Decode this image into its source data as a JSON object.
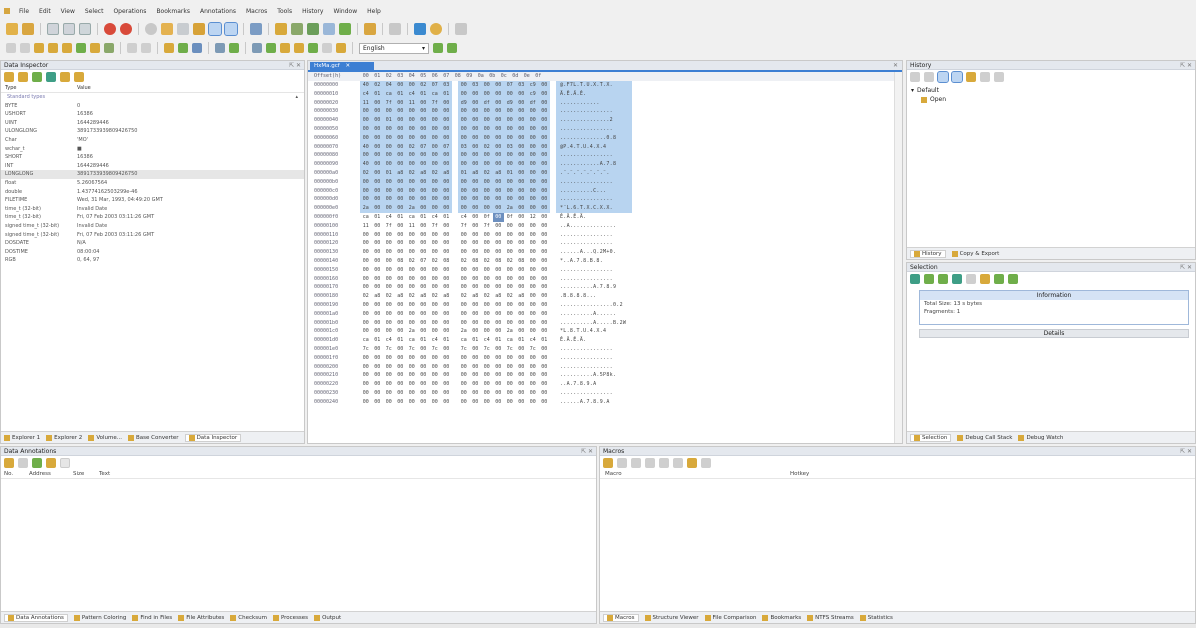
{
  "menu": [
    "File",
    "Edit",
    "View",
    "Select",
    "Operations",
    "Bookmarks",
    "Annotations",
    "Macros",
    "Tools",
    "History",
    "Window",
    "Help"
  ],
  "toolbar2": {
    "language": "English"
  },
  "colors": {
    "selection": "#b8d4f0",
    "tab_active": "#3d7fd3",
    "icon": "#d8a93b"
  },
  "data_inspector": {
    "title": "Data Inspector",
    "columns": [
      "Type",
      "Value"
    ],
    "group_label": "Standard types",
    "rows": [
      {
        "k": "BYTE",
        "v": "0"
      },
      {
        "k": "USHORT",
        "v": "16386"
      },
      {
        "k": "UINT",
        "v": "1644289446"
      },
      {
        "k": "ULONGLONG",
        "v": "3891733939809426750"
      },
      {
        "k": "Char",
        "v": "'MO'"
      },
      {
        "k": "wchar_t",
        "v": "■"
      },
      {
        "k": "SHORT",
        "v": "16386"
      },
      {
        "k": "INT",
        "v": "1644289446"
      },
      {
        "k": "LONGLONG",
        "v": "3891733939809426750"
      },
      {
        "k": "float",
        "v": "5.26067564"
      },
      {
        "k": "double",
        "v": "1.43774162503299e-46"
      },
      {
        "k": "FILETIME",
        "v": "Wed, 31 Mar, 1993, 04:49:20 GMT"
      },
      {
        "k": "time_t (32-bit)",
        "v": "Invalid Date"
      },
      {
        "k": "time_t (32-bit)",
        "v": "Fri, 07 Feb 2003 03:11:26 GMT"
      },
      {
        "k": "signed time_t (32-bit)",
        "v": "Invalid Date"
      },
      {
        "k": "signed time_t (32-bit)",
        "v": "Fri, 07 Feb 2003 03:11:26 GMT"
      },
      {
        "k": "DOSDATE",
        "v": "N/A"
      },
      {
        "k": "DOSTIME",
        "v": "08:00:04"
      },
      {
        "k": "RGB",
        "v": "0, 64, 97"
      }
    ],
    "tabs": [
      "Explorer 1",
      "Explorer 2",
      "Volume...",
      "Base Converter",
      "Data Inspector"
    ]
  },
  "hex_view": {
    "doc_tab": "HxMa.gcf",
    "header": [
      "00",
      "01",
      "02",
      "03",
      "04",
      "05",
      "06",
      "07",
      "08",
      "09",
      "0a",
      "0b",
      "0c",
      "0d",
      "0e",
      "0f"
    ],
    "rows": [
      {
        "off": "00000000",
        "h": [
          "40",
          "02",
          "04",
          "00",
          "00",
          "02",
          "07",
          "03",
          "00",
          "03",
          "00",
          "00",
          "07",
          "03",
          "c9",
          "00"
        ],
        "t": "@.F7L.T.U.X.T.X."
      },
      {
        "off": "00000010",
        "h": [
          "c4",
          "01",
          "ca",
          "01",
          "c4",
          "01",
          "ca",
          "01",
          "00",
          "00",
          "00",
          "00",
          "00",
          "00",
          "c9",
          "00"
        ],
        "t": "Ä.Ê.Ä.Ê."
      },
      {
        "off": "00000020",
        "h": [
          "11",
          "00",
          "7f",
          "00",
          "11",
          "00",
          "7f",
          "00",
          "d9",
          "00",
          "df",
          "00",
          "d9",
          "00",
          "df",
          "00"
        ],
        "t": "............"
      },
      {
        "off": "00000030",
        "h": [
          "00",
          "00",
          "00",
          "00",
          "00",
          "00",
          "00",
          "00",
          "00",
          "00",
          "00",
          "00",
          "00",
          "00",
          "00",
          "00"
        ],
        "t": "................"
      },
      {
        "off": "00000040",
        "h": [
          "00",
          "00",
          "01",
          "00",
          "00",
          "00",
          "00",
          "00",
          "00",
          "00",
          "00",
          "00",
          "00",
          "00",
          "00",
          "00"
        ],
        "t": "...............2"
      },
      {
        "off": "00000050",
        "h": [
          "00",
          "00",
          "00",
          "00",
          "00",
          "00",
          "00",
          "00",
          "00",
          "00",
          "00",
          "00",
          "00",
          "00",
          "00",
          "00"
        ],
        "t": "................"
      },
      {
        "off": "00000060",
        "h": [
          "00",
          "00",
          "00",
          "00",
          "00",
          "00",
          "00",
          "00",
          "00",
          "00",
          "00",
          "00",
          "00",
          "00",
          "00",
          "00"
        ],
        "t": "..............0.8"
      },
      {
        "off": "00000070",
        "h": [
          "40",
          "00",
          "00",
          "00",
          "02",
          "07",
          "00",
          "07",
          "03",
          "00",
          "02",
          "00",
          "03",
          "00",
          "00",
          "00"
        ],
        "t": "@P.4.T.U.4.X.4"
      },
      {
        "off": "00000080",
        "h": [
          "00",
          "00",
          "00",
          "00",
          "00",
          "00",
          "00",
          "00",
          "00",
          "00",
          "00",
          "00",
          "00",
          "00",
          "00",
          "00"
        ],
        "t": "................"
      },
      {
        "off": "00000090",
        "h": [
          "40",
          "00",
          "00",
          "00",
          "00",
          "00",
          "00",
          "00",
          "00",
          "00",
          "00",
          "00",
          "00",
          "00",
          "00",
          "00"
        ],
        "t": "............A.7.8"
      },
      {
        "off": "000000a0",
        "h": [
          "02",
          "00",
          "01",
          "a8",
          "02",
          "a8",
          "02",
          "a8",
          "01",
          "a8",
          "02",
          "a8",
          "01",
          "00",
          "00",
          "00"
        ],
        "t": ".¨.¨.¨.¨.¨.¨.¨."
      },
      {
        "off": "000000b0",
        "h": [
          "00",
          "00",
          "00",
          "00",
          "00",
          "00",
          "00",
          "00",
          "00",
          "00",
          "00",
          "00",
          "00",
          "00",
          "00",
          "00"
        ],
        "t": "................"
      },
      {
        "off": "000000c0",
        "h": [
          "00",
          "00",
          "00",
          "00",
          "00",
          "00",
          "00",
          "00",
          "00",
          "00",
          "00",
          "00",
          "00",
          "00",
          "00",
          "00"
        ],
        "t": "..........C..."
      },
      {
        "off": "000000d0",
        "h": [
          "00",
          "00",
          "00",
          "00",
          "00",
          "00",
          "00",
          "00",
          "00",
          "00",
          "00",
          "00",
          "00",
          "00",
          "00",
          "00"
        ],
        "t": "................"
      },
      {
        "off": "000000e0",
        "h": [
          "2a",
          "00",
          "00",
          "00",
          "2a",
          "00",
          "00",
          "00",
          "00",
          "00",
          "00",
          "00",
          "2a",
          "00",
          "00",
          "00"
        ],
        "t": "*¨L.6.T.X.C.X.X."
      },
      {
        "off": "000000f0",
        "h": [
          "ca",
          "01",
          "c4",
          "01",
          "ca",
          "01",
          "c4",
          "01",
          "c4",
          "00",
          "0f",
          "00",
          "0f",
          "00",
          "12",
          "00"
        ],
        "t": "Ê.Ä.Ê.Ä."
      },
      {
        "off": "00000100",
        "h": [
          "11",
          "00",
          "7f",
          "00",
          "11",
          "00",
          "7f",
          "00",
          "7f",
          "00",
          "7f",
          "00",
          "00",
          "00",
          "00",
          "00"
        ],
        "t": "..A.............."
      },
      {
        "off": "00000110",
        "h": [
          "00",
          "00",
          "00",
          "00",
          "00",
          "00",
          "00",
          "00",
          "00",
          "00",
          "00",
          "00",
          "00",
          "00",
          "00",
          "00"
        ],
        "t": "................"
      },
      {
        "off": "00000120",
        "h": [
          "00",
          "00",
          "00",
          "00",
          "00",
          "00",
          "00",
          "00",
          "00",
          "00",
          "00",
          "00",
          "00",
          "00",
          "00",
          "00"
        ],
        "t": "................"
      },
      {
        "off": "00000130",
        "h": [
          "00",
          "00",
          "00",
          "00",
          "00",
          "00",
          "00",
          "00",
          "00",
          "00",
          "00",
          "00",
          "00",
          "00",
          "00",
          "00"
        ],
        "t": "......A...Q.2M+0."
      },
      {
        "off": "00000140",
        "h": [
          "00",
          "00",
          "00",
          "08",
          "02",
          "07",
          "02",
          "08",
          "02",
          "08",
          "02",
          "08",
          "02",
          "08",
          "00",
          "00"
        ],
        "t": "*..A.7.8.B.8."
      },
      {
        "off": "00000150",
        "h": [
          "00",
          "00",
          "00",
          "00",
          "00",
          "00",
          "00",
          "00",
          "00",
          "00",
          "00",
          "00",
          "00",
          "00",
          "00",
          "00"
        ],
        "t": "................"
      },
      {
        "off": "00000160",
        "h": [
          "00",
          "00",
          "00",
          "00",
          "00",
          "00",
          "00",
          "00",
          "00",
          "00",
          "00",
          "00",
          "00",
          "00",
          "00",
          "00"
        ],
        "t": "................"
      },
      {
        "off": "00000170",
        "h": [
          "00",
          "00",
          "00",
          "00",
          "00",
          "00",
          "00",
          "00",
          "00",
          "00",
          "00",
          "00",
          "00",
          "00",
          "00",
          "00"
        ],
        "t": "..........A.7.8.9"
      },
      {
        "off": "00000180",
        "h": [
          "02",
          "a8",
          "02",
          "a8",
          "02",
          "a8",
          "02",
          "a8",
          "02",
          "a8",
          "02",
          "a8",
          "02",
          "a8",
          "00",
          "00"
        ],
        "t": ".B.8.8.8..."
      },
      {
        "off": "00000190",
        "h": [
          "00",
          "00",
          "00",
          "00",
          "00",
          "00",
          "00",
          "00",
          "00",
          "00",
          "00",
          "00",
          "00",
          "00",
          "00",
          "00"
        ],
        "t": "................0.2"
      },
      {
        "off": "000001a0",
        "h": [
          "00",
          "00",
          "00",
          "00",
          "00",
          "00",
          "00",
          "00",
          "00",
          "00",
          "00",
          "00",
          "00",
          "00",
          "00",
          "00"
        ],
        "t": "..........A......"
      },
      {
        "off": "000001b0",
        "h": [
          "00",
          "00",
          "00",
          "00",
          "00",
          "00",
          "00",
          "00",
          "00",
          "00",
          "00",
          "00",
          "00",
          "00",
          "00",
          "00"
        ],
        "t": "..........A.....B.2W"
      },
      {
        "off": "000001c0",
        "h": [
          "00",
          "00",
          "00",
          "00",
          "2a",
          "00",
          "00",
          "00",
          "2a",
          "00",
          "00",
          "00",
          "2a",
          "00",
          "00",
          "00"
        ],
        "t": "*L.8.T.U.4.X.4"
      },
      {
        "off": "000001d0",
        "h": [
          "ca",
          "01",
          "c4",
          "01",
          "ca",
          "01",
          "c4",
          "01",
          "ca",
          "01",
          "c4",
          "01",
          "ca",
          "01",
          "c4",
          "01"
        ],
        "t": "Ê.Ä.Ê.Ä."
      },
      {
        "off": "000001e0",
        "h": [
          "7c",
          "00",
          "7c",
          "00",
          "7c",
          "00",
          "7c",
          "00",
          "7c",
          "00",
          "7c",
          "00",
          "7c",
          "00",
          "7c",
          "00"
        ],
        "t": "................"
      },
      {
        "off": "000001f0",
        "h": [
          "00",
          "00",
          "00",
          "00",
          "00",
          "00",
          "00",
          "00",
          "00",
          "00",
          "00",
          "00",
          "00",
          "00",
          "00",
          "00"
        ],
        "t": "................"
      },
      {
        "off": "00000200",
        "h": [
          "00",
          "00",
          "00",
          "00",
          "00",
          "00",
          "00",
          "00",
          "00",
          "00",
          "00",
          "00",
          "00",
          "00",
          "00",
          "00"
        ],
        "t": "................"
      },
      {
        "off": "00000210",
        "h": [
          "00",
          "00",
          "00",
          "00",
          "00",
          "00",
          "00",
          "00",
          "00",
          "00",
          "00",
          "00",
          "00",
          "00",
          "00",
          "00"
        ],
        "t": "..........A.5P8k."
      },
      {
        "off": "00000220",
        "h": [
          "00",
          "00",
          "00",
          "00",
          "00",
          "00",
          "00",
          "00",
          "00",
          "00",
          "00",
          "00",
          "00",
          "00",
          "00",
          "00"
        ],
        "t": "..A.7.8.9.A"
      },
      {
        "off": "00000230",
        "h": [
          "00",
          "00",
          "00",
          "00",
          "00",
          "00",
          "00",
          "00",
          "00",
          "00",
          "00",
          "00",
          "00",
          "00",
          "00",
          "00"
        ],
        "t": "................"
      },
      {
        "off": "00000240",
        "h": [
          "00",
          "00",
          "00",
          "00",
          "00",
          "00",
          "00",
          "00",
          "00",
          "00",
          "00",
          "00",
          "00",
          "00",
          "00",
          "00"
        ],
        "t": "......A.7.8.9.A"
      }
    ]
  },
  "history": {
    "title": "History",
    "root": "Default",
    "child": "Open",
    "tabs": [
      "History",
      "Copy & Export"
    ]
  },
  "selection": {
    "title": "Selection",
    "info_title": "Information",
    "total_size": "Total Size:   13 s   bytes",
    "fragments": "Fragments:   1",
    "details": "Details",
    "tabs": [
      "Selection",
      "Debug Call Stack",
      "Debug Watch"
    ]
  },
  "annotations": {
    "title": "Data Annotations",
    "columns": [
      "No.",
      "Address",
      "Size",
      "Text"
    ],
    "tabs": [
      "Data Annotations",
      "Pattern Coloring",
      "Find in Files",
      "File Attributes",
      "Checksum",
      "Processes",
      "Output"
    ]
  },
  "macros": {
    "title": "Macros",
    "columns": [
      "Macro",
      "Hotkey"
    ],
    "tabs": [
      "Macros",
      "Structure Viewer",
      "File Comparison",
      "Bookmarks",
      "NTFS Streams",
      "Statistics"
    ]
  }
}
